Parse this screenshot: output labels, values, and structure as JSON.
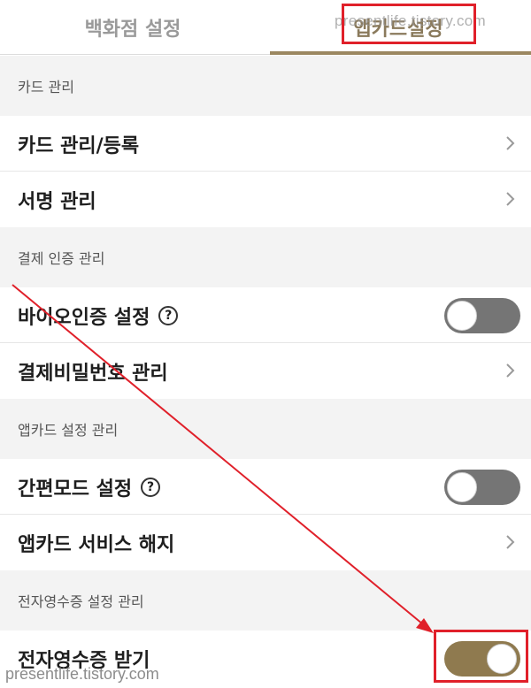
{
  "tabs": [
    {
      "label": "백화점 설정"
    },
    {
      "label": "앱카드설정"
    }
  ],
  "sections": [
    {
      "label": "카드 관리"
    },
    {
      "label": "결제 인증 관리"
    },
    {
      "label": "앱카드 설정 관리"
    },
    {
      "label": "전자영수증 설정 관리"
    }
  ],
  "rows": [
    {
      "label": "카드 관리/등록"
    },
    {
      "label": "서명 관리"
    },
    {
      "label": "바이오인증 설정",
      "toggle": "off"
    },
    {
      "label": "결제비밀번호 관리"
    },
    {
      "label": "간편모드 설정",
      "toggle": "off"
    },
    {
      "label": "앱카드 서비스 해지"
    },
    {
      "label": "전자영수증 받기",
      "toggle": "on"
    }
  ],
  "help_glyph": "?",
  "watermarks": {
    "top": "presentlife.tistory.com",
    "bottom": "presentlife.tistory.com"
  },
  "colors": {
    "accent": "#9b8760",
    "toggle_on": "#8f7a4f",
    "toggle_off": "#757575",
    "annotation_red": "#e0202a"
  }
}
